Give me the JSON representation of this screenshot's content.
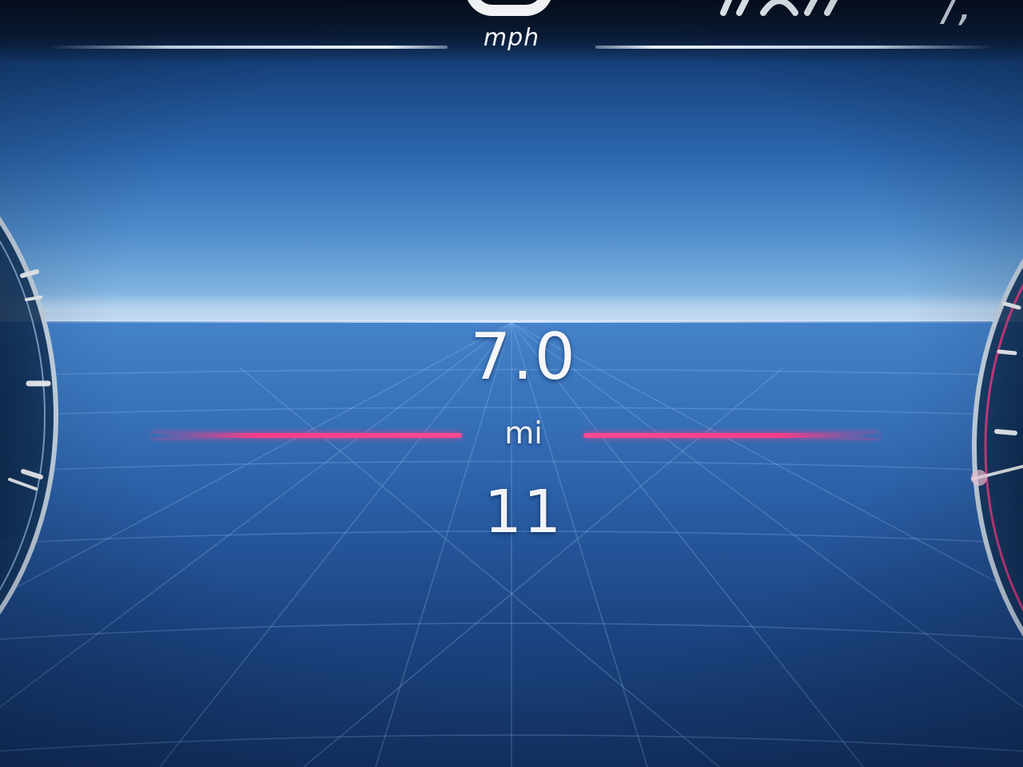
{
  "speed": {
    "unit": "mph"
  },
  "trip": {
    "value": "7.0",
    "unit": "mi",
    "secondary_value": "11"
  },
  "colors": {
    "accent": "#ff3b86",
    "background": "#2b66ad",
    "text": "#f4f6f8"
  },
  "icons": {
    "assist": "driving-assist-icon"
  }
}
